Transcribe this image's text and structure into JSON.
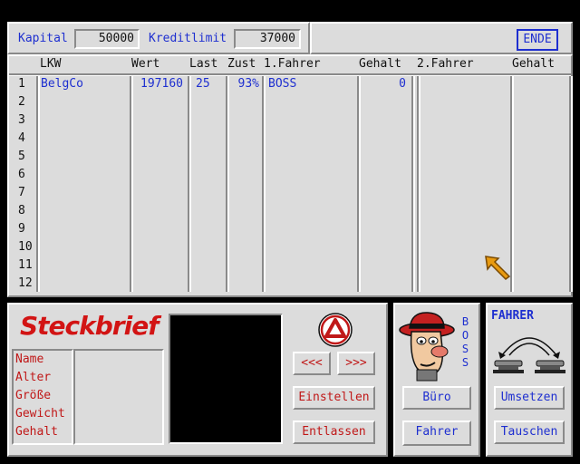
{
  "top_bar": {
    "kapital_label": "Kapital",
    "kapital_value": "50000",
    "kreditlimit_label": "Kreditlimit",
    "kreditlimit_value": "37000",
    "ende_label": "ENDE"
  },
  "table": {
    "headers": [
      "LKW",
      "Wert",
      "Last",
      "Zust",
      "1.Fahrer",
      "Gehalt",
      "2.Fahrer",
      "Gehalt"
    ],
    "row_numbers": [
      "1",
      "2",
      "3",
      "4",
      "5",
      "6",
      "7",
      "8",
      "9",
      "10",
      "11",
      "12"
    ],
    "rows": [
      {
        "lkw": "BelgCo",
        "wert": "197160",
        "last": "25",
        "zust": "93%",
        "fahrer1": "BOSS",
        "gehalt1": "0",
        "fahrer2": "",
        "gehalt2": ""
      }
    ]
  },
  "steckbrief": {
    "title": "Steckbrief",
    "fields": [
      "Name",
      "Alter",
      "Größe",
      "Gewicht",
      "Gehalt"
    ]
  },
  "nav": {
    "prev_label": "<<<",
    "next_label": ">>>",
    "einstellen_label": "Einstellen",
    "entlassen_label": "Entlassen"
  },
  "boss_panel": {
    "vertical_label": "BOSS",
    "buero_label": "Büro",
    "fahrer_label": "Fahrer"
  },
  "fahrer_panel": {
    "title": "FAHRER",
    "umsetzen_label": "Umsetzen",
    "tauschen_label": "Tauschen"
  },
  "colors": {
    "panel_bg": "#dcdcdc",
    "text_blue": "#1e2fd0",
    "text_red": "#c01818",
    "steckbrief_red": "#d21414",
    "cursor_orange": "#e89a10"
  },
  "icons": [
    "cursor-arrow-icon",
    "hazard-triangle-icon",
    "boss-face-icon",
    "swap-drivers-icon"
  ]
}
